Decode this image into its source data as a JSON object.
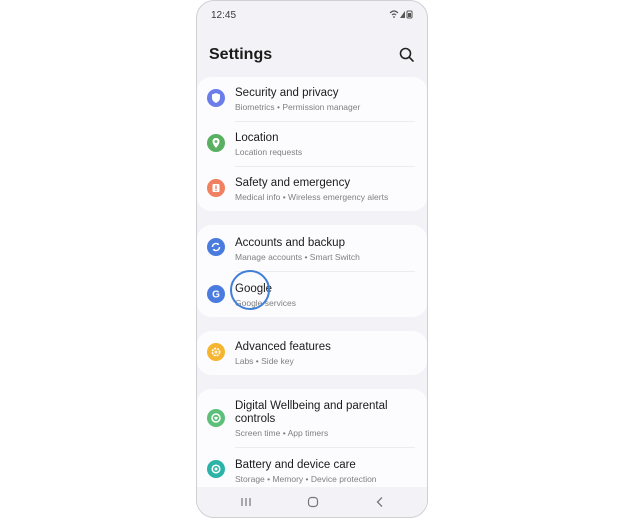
{
  "status_bar": {
    "time": "12:45",
    "icons": [
      "wifi-icon",
      "signal-icon",
      "battery-icon"
    ]
  },
  "header": {
    "title": "Settings",
    "search_icon": "search-icon"
  },
  "colors": {
    "security_icon_bg": "#6b7de8",
    "location_icon_bg": "#58b060",
    "safety_icon_bg": "#f08060",
    "accounts_icon_bg": "#4a7ce0",
    "google_icon_bg": "#4a7ce0",
    "advanced_icon_bg": "#f5b530",
    "wellbeing_icon_bg": "#5cbf7a",
    "battery_icon_bg": "#2bb3a8",
    "highlight_ring": "#3f7fd6"
  },
  "groups": [
    {
      "items": [
        {
          "title": "Security and privacy",
          "subtitle": "Biometrics  •  Permission manager",
          "icon": "shield-icon"
        },
        {
          "title": "Location",
          "subtitle": "Location requests",
          "icon": "location-pin-icon"
        },
        {
          "title": "Safety and emergency",
          "subtitle": "Medical info  •  Wireless emergency alerts",
          "icon": "emergency-icon"
        }
      ]
    },
    {
      "items": [
        {
          "title": "Accounts and backup",
          "subtitle": "Manage accounts  •  Smart Switch",
          "icon": "sync-icon"
        },
        {
          "title": "Google",
          "subtitle": "Google services",
          "icon": "google-g-icon"
        }
      ]
    },
    {
      "items": [
        {
          "title": "Advanced features",
          "subtitle": "Labs  •  Side key",
          "icon": "gear-plus-icon"
        }
      ]
    },
    {
      "items": [
        {
          "title": "Digital Wellbeing and parental controls",
          "subtitle": "Screen time  •  App timers",
          "icon": "wellbeing-icon"
        },
        {
          "title": "Battery and device care",
          "subtitle": "Storage  •  Memory  •  Device protection",
          "icon": "device-care-icon"
        }
      ]
    }
  ],
  "nav_bar": {
    "buttons": [
      "recents-icon",
      "home-icon",
      "back-icon"
    ]
  }
}
